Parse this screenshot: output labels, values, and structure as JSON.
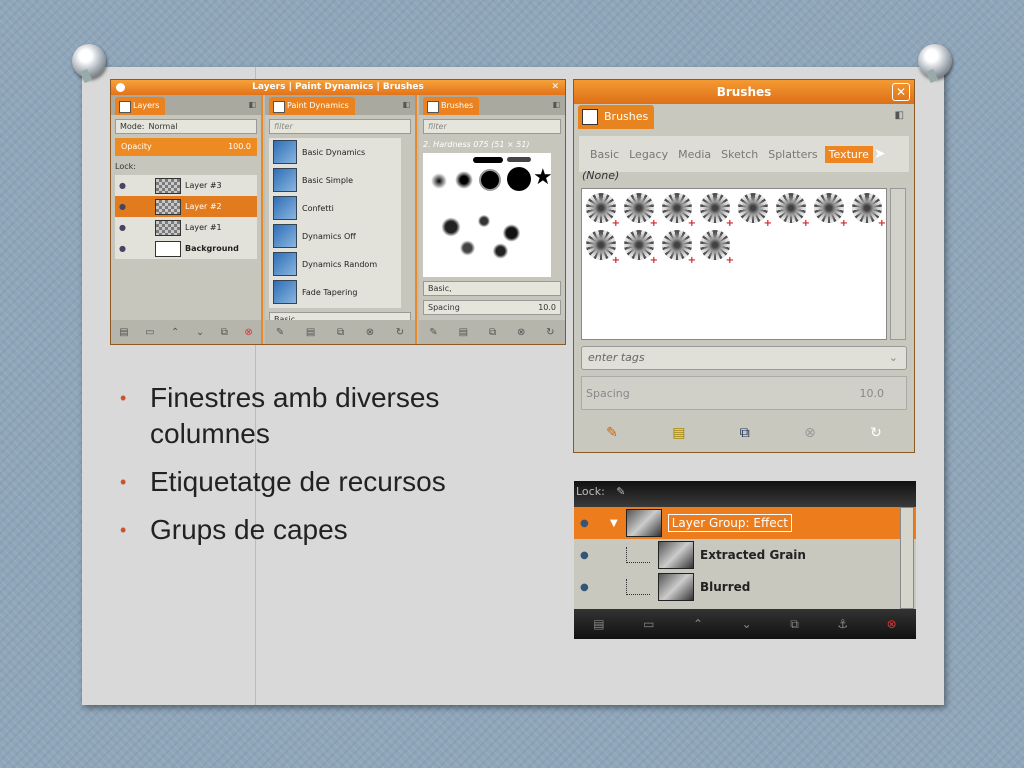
{
  "win1": {
    "title": "Layers | Paint Dynamics | Brushes",
    "layers": {
      "tab": "Layers",
      "mode_label": "Mode:",
      "mode": "Normal",
      "opacity_label": "Opacity",
      "opacity": "100.0",
      "lock_label": "Lock:",
      "rows": [
        "Layer #3",
        "Layer #2",
        "Layer #1",
        "Background"
      ]
    },
    "dynamics": {
      "tab": "Paint Dynamics",
      "filter": "filter",
      "items": [
        "Basic Dynamics",
        "Basic Simple",
        "Confetti",
        "Dynamics Off",
        "Dynamics Random",
        "Fade Tapering"
      ],
      "tag": "Basic,"
    },
    "brushes": {
      "tab": "Brushes",
      "filter": "filter",
      "current": "2. Hardness 075 (51 × 51)",
      "tag": "Basic,",
      "spacing_label": "Spacing",
      "spacing": "10.0"
    }
  },
  "win2": {
    "title": "Brushes",
    "tab": "Brushes",
    "tags": [
      "Basic",
      "Legacy",
      "Media",
      "Sketch",
      "Splatters",
      "Texture"
    ],
    "active_tag": "Texture",
    "none_label": "(None)",
    "tags_placeholder": "enter tags",
    "spacing_label": "Spacing",
    "spacing": "10.0"
  },
  "bullets": [
    "Finestres amb diverses columnes",
    "Etiquetatge de recursos",
    "Grups de capes"
  ],
  "win3": {
    "lock_label": "Lock:",
    "rows": [
      {
        "label": "Layer Group: Effect"
      },
      {
        "label": "Extracted Grain"
      },
      {
        "label": "Blurred"
      }
    ]
  },
  "colors": {
    "accent": "#ec8522",
    "bullet": "#c9552a"
  }
}
